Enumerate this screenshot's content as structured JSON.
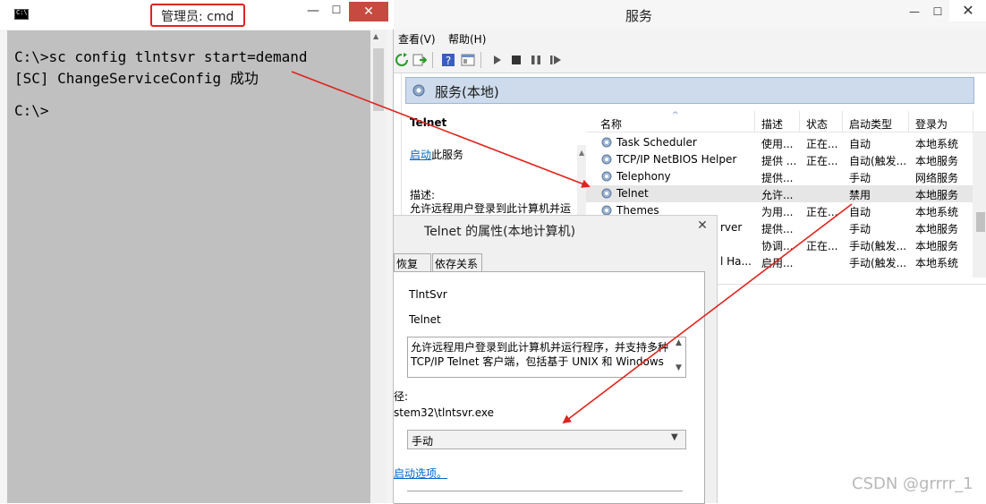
{
  "cmd": {
    "title": "管理员: cmd",
    "icon_label": "C:\\",
    "lines": [
      "C:\\>sc config tlntsvr start=demand",
      "[SC] ChangeServiceConfig 成功",
      "",
      "C:\\>"
    ],
    "title_highlight_color": "#e0231d"
  },
  "services": {
    "title": "服务",
    "menu": [
      "查看(V)",
      "帮助(H)"
    ],
    "header": "服务(本地)",
    "detail": {
      "title": "Telnet",
      "start_link": "启动",
      "start_suffix": "此服务",
      "desc_label": "描述:",
      "desc_text": "允许远程用户登录到此计算机并运"
    },
    "columns": [
      "名称",
      "描述",
      "状态",
      "启动类型",
      "登录为"
    ],
    "rows": [
      {
        "name": "Task Scheduler",
        "desc": "使用...",
        "status": "正在...",
        "startup": "自动",
        "logon": "本地系统"
      },
      {
        "name": "TCP/IP NetBIOS Helper",
        "desc": "提供 ...",
        "status": "正在...",
        "startup": "自动(触发...",
        "logon": "本地服务"
      },
      {
        "name": "Telephony",
        "desc": "提供...",
        "status": "",
        "startup": "手动",
        "logon": "网络服务"
      },
      {
        "name": "Telnet",
        "desc": "允许...",
        "status": "",
        "startup": "禁用",
        "logon": "本地服务",
        "selected": true
      },
      {
        "name": "Themes",
        "desc": "为用...",
        "status": "正在...",
        "startup": "自动",
        "logon": "本地系统"
      },
      {
        "name": "rver",
        "desc": "提供...",
        "status": "",
        "startup": "手动",
        "logon": "本地服务"
      },
      {
        "name": "",
        "desc": "协调...",
        "status": "正在...",
        "startup": "手动(触发...",
        "logon": "本地服务"
      },
      {
        "name": "l Ha...",
        "desc": "启用...",
        "status": "",
        "startup": "手动(触发...",
        "logon": "本地系统"
      }
    ]
  },
  "dialog": {
    "title": "Telnet 的属性(本地计算机)",
    "tabs": [
      "恢复",
      "依存关系"
    ],
    "service_name": "TlntSvr",
    "display_name": "Telnet",
    "description_line1": "允许远程用户登录到此计算机并运行程序，并支持多种",
    "description_line2": "TCP/IP Telnet 客户端，包括基于 UNIX 和 Windows",
    "path_label": "径:",
    "path_value": "stem32\\tlntsvr.exe",
    "startup_type": "手动",
    "startup_help_link": "启动选项。"
  },
  "watermark": "CSDN @grrrr_1",
  "colors": {
    "arrow": "#e0231d",
    "header_bg": "#cddbec",
    "console_bg": "#c0c0c0",
    "close_red": "#c74a40"
  }
}
